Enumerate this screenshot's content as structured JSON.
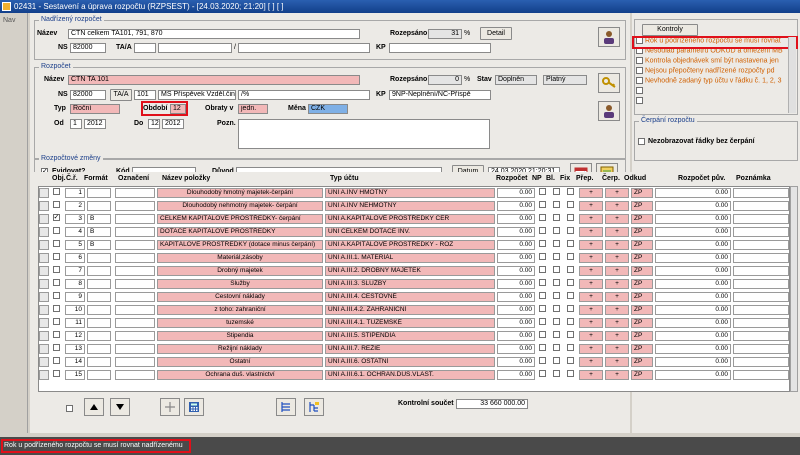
{
  "window": {
    "title": "02431 - Sestavení a úprava rozpočtu (RZPSEST) - [24.03.2020; 21:20]  [ ]  [ ]"
  },
  "nav": {
    "label": "Nav"
  },
  "nadrizeny": {
    "title": "Nadřízený rozpočet",
    "nazev_label": "Název",
    "nazev_value": "CTN celkem TA101, 791, 870",
    "rozepsano_label": "Rozepsáno",
    "rozepsano_value": "31",
    "percent": "%",
    "detail_button": "Detail",
    "ns_label": "NS",
    "ns_value": "82000",
    "taa_label": "TA/A",
    "slash": "/",
    "kp_label": "KP"
  },
  "rozpocet": {
    "title": "Rozpočet",
    "nazev_label": "Název",
    "nazev_value": "CTN TA 101",
    "rozepsano_label": "Rozepsáno",
    "rozepsano_value": "0",
    "percent": "%",
    "stav_label": "Stav",
    "stav_value": "Doplněn",
    "stav_value2": "Platný",
    "ns_label": "NS",
    "ns_value": "82000",
    "taa_button": "TA/A",
    "ta_value": "101",
    "ms_value": "MŠ Příspěvek Vzděl.činn",
    "slash_value": "/%",
    "kp_label": "KP",
    "kp_value": "9NP-Neplnění/NČ-Příspě",
    "typ_label": "Typ",
    "typ_value": "Roční",
    "obdobi_label": "Období",
    "obdobi_value": "12",
    "obraty_label": "Obraty v",
    "obraty_value": "jedn.",
    "mena_label": "Měna",
    "mena_value": "CZK",
    "od_label": "Od",
    "od_month": "1",
    "od_year": "2012",
    "do_label": "Do",
    "do_month": "12",
    "do_year": "2012",
    "pozn_label": "Pozn."
  },
  "zmeny": {
    "title": "Rozpočtové změny",
    "evidovat_label": "Evidovat?",
    "kod_label": "Kód",
    "duvod_label": "Důvod",
    "datum_button": "Datum",
    "datum_value": "24.03.2020 21:20:31"
  },
  "kontroly": {
    "button": "Kontroly",
    "items": [
      "Rok u podřízeného rozpočtu se musí rovnat",
      "Nesoulad parametru ODKUD a omezení MB",
      "Kontrola objednávek smí být nastavena jen",
      "Nejsou přepočteny nadřízené rozpočty pd",
      "Nevhodně zadaný typ účtu v řádku č. 1, 2, 3"
    ]
  },
  "cerpani": {
    "title": "Čerpání rozpočtu",
    "checkbox_label": "Nezobrazovat řádky bez čerpání"
  },
  "table": {
    "headers": {
      "obj": "Obj.",
      "cr": "Č.ř.",
      "format": "Formát",
      "oznaceni": "Označení",
      "nazev": "Název položky",
      "typ": "Typ účtu",
      "rozpocet": "Rozpočet",
      "np": "NP",
      "bl": "Bl.",
      "fix": "Fix",
      "prep": "Přep.",
      "cerp": "Čerp.",
      "odkud": "Odkud",
      "puv": "Rozpočet pův.",
      "poznamka": "Poznámka"
    },
    "rows": [
      {
        "cr": "1",
        "format": "",
        "nazev": "Dlouhodobý hmotný majetek-čerpání",
        "typ": "UNI A.INV HMOTNÝ",
        "rozpocet": "0.00",
        "plus1": "+",
        "plus2": "+",
        "odkud": "ZP",
        "puv": "0.00",
        "checked": false
      },
      {
        "cr": "2",
        "format": "",
        "nazev": "Dlouhodobý nehmotný majetek- čerpání",
        "typ": "UNI A.INV NEHMOTNÝ",
        "rozpocet": "0.00",
        "plus1": "+",
        "plus2": "+",
        "odkud": "ZP",
        "puv": "0.00",
        "checked": false
      },
      {
        "cr": "3",
        "format": "B",
        "nazev": "CELKEM KAPITÁLOVÉ PROSTŘEDKY- čerpání",
        "typ": "UNI A.KAPITÁLOVÉ PROSTŘEDKY ČER",
        "rozpocet": "0.00",
        "plus1": "+",
        "plus2": "+",
        "odkud": "ZP",
        "puv": "0.00",
        "checked": true
      },
      {
        "cr": "4",
        "format": "B",
        "nazev": "DOTACE KAPITÁLOVÉ PROSTŘEDKY",
        "typ": "UNI CELKEM DOTACE INV.",
        "rozpocet": "0.00",
        "plus1": "+",
        "plus2": "+",
        "odkud": "ZP",
        "puv": "0.00",
        "checked": false
      },
      {
        "cr": "5",
        "format": "B",
        "nazev": "KAPITÁLOVÉ PROSTŘEDKY (dotace minus čerpání)",
        "typ": "UNI A.KAPITÁLOVÉ PROSTŘEDKY - ROZ",
        "rozpocet": "0.00",
        "plus1": "+",
        "plus2": "+",
        "odkud": "ZP",
        "puv": "0.00",
        "checked": false
      },
      {
        "cr": "6",
        "format": "",
        "nazev": "Materiál,zásoby",
        "typ": "UNI A.III.1. MATERIÁL",
        "rozpocet": "0.00",
        "plus1": "+",
        "plus2": "+",
        "odkud": "ZP",
        "puv": "0.00",
        "checked": false
      },
      {
        "cr": "7",
        "format": "",
        "nazev": "Drobný majetek",
        "typ": "UNI A.III.2. DROBNÝ MAJETEK",
        "rozpocet": "0.00",
        "plus1": "+",
        "plus2": "+",
        "odkud": "ZP",
        "puv": "0.00",
        "checked": false
      },
      {
        "cr": "8",
        "format": "",
        "nazev": "Služby",
        "typ": "UNI A.III.3. SLUŽBY",
        "rozpocet": "0.00",
        "plus1": "+",
        "plus2": "+",
        "odkud": "ZP",
        "puv": "0.00",
        "checked": false
      },
      {
        "cr": "9",
        "format": "",
        "nazev": "Cestovní náklady",
        "typ": "UNI A.III.4. CESTOVNÉ",
        "rozpocet": "0.00",
        "plus1": "+",
        "plus2": "+",
        "odkud": "ZP",
        "puv": "0.00",
        "checked": false
      },
      {
        "cr": "10",
        "format": "",
        "nazev": "z toho: zahraniční",
        "typ": "UNI A.III.4.2. ZAHRANIČNÍ",
        "rozpocet": "0.00",
        "plus1": "+",
        "plus2": "+",
        "odkud": "ZP",
        "puv": "0.00",
        "checked": false
      },
      {
        "cr": "11",
        "format": "",
        "nazev": "tuzemské",
        "typ": "UNI A.III.4.1. TUZEMSKÉ",
        "rozpocet": "0.00",
        "plus1": "+",
        "plus2": "+",
        "odkud": "ZP",
        "puv": "0.00",
        "checked": false
      },
      {
        "cr": "12",
        "format": "",
        "nazev": "Stipendia",
        "typ": "UNI A.III.5. STIPENDIA",
        "rozpocet": "0.00",
        "plus1": "+",
        "plus2": "+",
        "odkud": "ZP",
        "puv": "0.00",
        "checked": false
      },
      {
        "cr": "13",
        "format": "",
        "nazev": "Režijní náklady",
        "typ": "UNI A.III.7. REŽIE",
        "rozpocet": "0.00",
        "plus1": "+",
        "plus2": "+",
        "odkud": "ZP",
        "puv": "0.00",
        "checked": false
      },
      {
        "cr": "14",
        "format": "",
        "nazev": "Ostatní",
        "typ": "UNI A.III.6. OSTATNÍ",
        "rozpocet": "0.00",
        "plus1": "+",
        "plus2": "+",
        "odkud": "ZP",
        "puv": "0.00",
        "checked": false
      },
      {
        "cr": "15",
        "format": "",
        "nazev": "Ochrana duš. vlastnictví",
        "typ": "UNI A.III.6.1. OCHRAN.DUS.VLAST.",
        "rozpocet": "0.00",
        "plus1": "+",
        "plus2": "+",
        "odkud": "ZP",
        "puv": "0.00",
        "checked": false
      }
    ]
  },
  "footer": {
    "kontrolni_label": "Kontrolní součet",
    "kontrolni_value": "33 660 000.00"
  },
  "status": {
    "message": "Rok u podřízeného rozpočtu se musí rovnat nadřízenému"
  },
  "icons": [
    "app-icon",
    "person-icon",
    "keys-icon",
    "calendar-icon",
    "note-icon",
    "arrow-up-icon",
    "arrow-down-icon",
    "insert-icon",
    "calculator-icon",
    "tree-icon",
    "tree-level-icon"
  ],
  "colors": {
    "pink": "#f2b8b8",
    "title_blue": "#1a3e8a",
    "highlight_red": "#e0101a",
    "currency_blue": "#7fb0e6",
    "status_bg": "#4a4a4a",
    "kontroly_orange": "#d06000"
  }
}
